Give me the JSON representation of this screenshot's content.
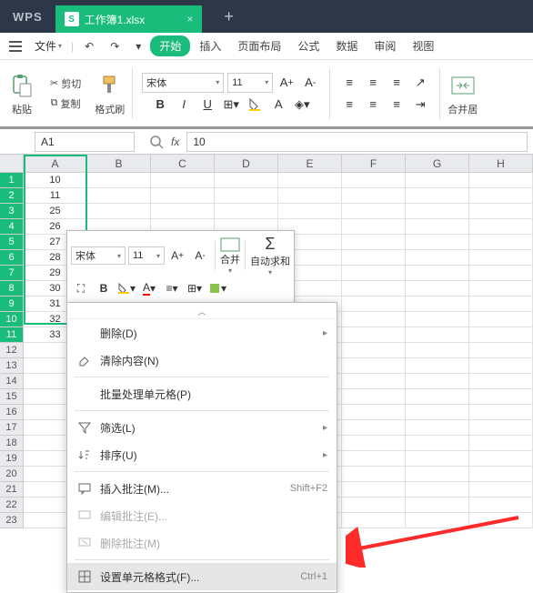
{
  "titlebar": {
    "logo": "WPS",
    "tab_icon": "S",
    "tab_label": "工作簿1.xlsx",
    "tab_close": "×",
    "new_tab": "+"
  },
  "menubar": {
    "file": "文件",
    "items": [
      "开始",
      "插入",
      "页面布局",
      "公式",
      "数据",
      "审阅",
      "视图"
    ]
  },
  "toolbar": {
    "paste": "粘贴",
    "cut": "剪切",
    "copy": "复制",
    "format_painter": "格式刷",
    "font_name": "宋体",
    "font_size": "11",
    "merge": "合并居"
  },
  "formula_bar": {
    "name_box": "A1",
    "fx": "fx",
    "value": "10"
  },
  "grid": {
    "cols": [
      "A",
      "B",
      "C",
      "D",
      "E",
      "F",
      "G",
      "H"
    ],
    "rows": [
      {
        "n": 1,
        "a": "10"
      },
      {
        "n": 2,
        "a": "11"
      },
      {
        "n": 3,
        "a": "25"
      },
      {
        "n": 4,
        "a": "26"
      },
      {
        "n": 5,
        "a": "27"
      },
      {
        "n": 6,
        "a": "28"
      },
      {
        "n": 7,
        "a": "29"
      },
      {
        "n": 8,
        "a": "30"
      },
      {
        "n": 9,
        "a": "31"
      },
      {
        "n": 10,
        "a": "32"
      },
      {
        "n": 11,
        "a": "33"
      },
      {
        "n": 12,
        "a": ""
      },
      {
        "n": 13,
        "a": ""
      },
      {
        "n": 14,
        "a": ""
      },
      {
        "n": 15,
        "a": ""
      },
      {
        "n": 16,
        "a": ""
      },
      {
        "n": 17,
        "a": ""
      },
      {
        "n": 18,
        "a": ""
      },
      {
        "n": 19,
        "a": ""
      },
      {
        "n": 20,
        "a": ""
      },
      {
        "n": 21,
        "a": ""
      },
      {
        "n": 22,
        "a": ""
      },
      {
        "n": 23,
        "a": ""
      }
    ]
  },
  "mini": {
    "font_name": "宋体",
    "font_size": "11",
    "merge": "合并",
    "autosum": "自动求和"
  },
  "context_menu": {
    "delete": "删除(D)",
    "clear": "清除内容(N)",
    "batch": "批量处理单元格(P)",
    "filter": "筛选(L)",
    "sort": "排序(U)",
    "insert_comment": "插入批注(M)...",
    "insert_comment_shortcut": "Shift+F2",
    "edit_comment": "编辑批注(E)...",
    "delete_comment": "删除批注(M)",
    "format_cells": "设置单元格格式(F)...",
    "format_cells_shortcut": "Ctrl+1"
  }
}
